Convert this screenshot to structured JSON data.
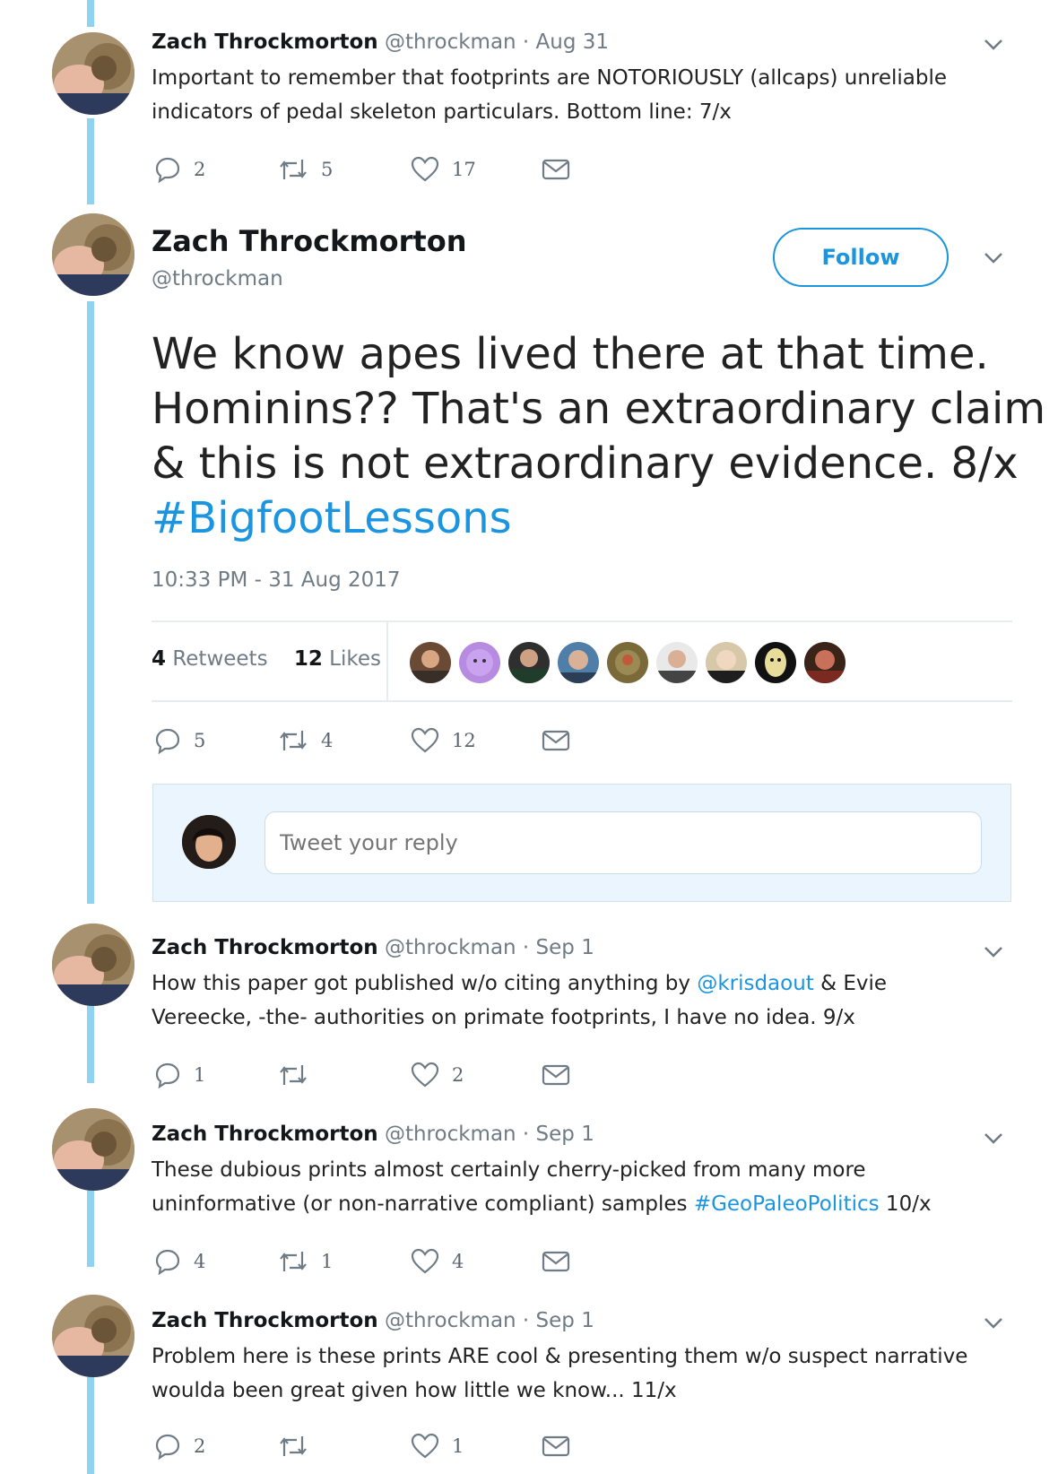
{
  "tweets": [
    {
      "name": "Zach Throckmorton",
      "meta": "@throckman · Aug 31",
      "line1": "Important to remember that footprints are NOTORIOUSLY (allcaps) unreliable",
      "line2": "indicators of pedal skeleton particulars. Bottom line: 7/x",
      "reply_count": "2",
      "retweet_count": "5",
      "like_count": "17"
    },
    {
      "name": "Zach Throckmorton",
      "meta": "@throckman · Sep 1",
      "line1_pre": "How this paper got published w/o citing anything by ",
      "line1_link": "@krisdaout",
      "line1_post": " & Evie",
      "line2": "Vereecke, -the- authorities on primate footprints, I have no idea. 9/x",
      "reply_count": "1",
      "retweet_count": "",
      "like_count": "2"
    },
    {
      "name": "Zach Throckmorton",
      "meta": "@throckman · Sep 1",
      "line1": "These dubious prints almost certainly cherry-picked from many more",
      "line2_pre": "uninformative (or non-narrative compliant) samples ",
      "line2_link": "#GeoPaleoPolitics",
      "line2_post": " 10/x",
      "reply_count": "4",
      "retweet_count": "1",
      "like_count": "4"
    },
    {
      "name": "Zach Throckmorton",
      "meta": "@throckman · Sep 1",
      "line1": "Problem here is these prints ARE cool & presenting them w/o suspect narrative",
      "line2": "woulda been great given how little we know... 11/x",
      "reply_count": "2",
      "retweet_count": "",
      "like_count": "1"
    }
  ],
  "main": {
    "name": "Zach Throckmorton",
    "handle": "@throckman",
    "follow_label": "Follow",
    "text_lines": [
      "We know apes lived there at that time.",
      "Hominins?? That's an extraordinary claim",
      "& this is not extraordinary evidence. 8/x"
    ],
    "hashtag": "#BigfootLessons",
    "timestamp": "10:33 PM - 31 Aug 2017",
    "retweets_num": "4",
    "retweets_label": "Retweets",
    "likes_num": "12",
    "likes_label": "Likes",
    "reply_count": "5",
    "retweet_count": "4",
    "like_count": "12"
  },
  "reply": {
    "placeholder": "Tweet your reply"
  },
  "colors": {
    "accent": "#1b95e0",
    "thread_line": "#8fd3f0",
    "muted": "#6f7b85"
  },
  "icons": [
    "reply-icon",
    "retweet-icon",
    "like-icon",
    "direct-message-icon",
    "chevron-down-icon"
  ]
}
